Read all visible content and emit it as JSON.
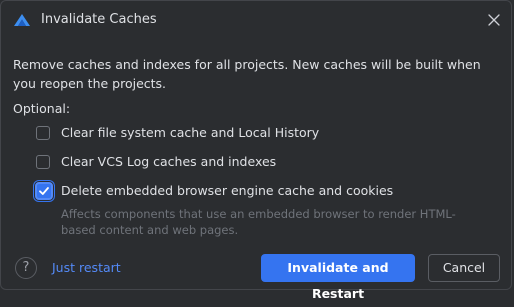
{
  "dialog": {
    "title": "Invalidate Caches",
    "description": "Remove caches and indexes for all projects. New caches will be built when you reopen the projects.",
    "optional_label": "Optional:",
    "options": [
      {
        "label": "Clear file system cache and Local History",
        "checked": false
      },
      {
        "label": "Clear VCS Log caches and indexes",
        "checked": false
      },
      {
        "label": "Delete embedded browser engine cache and cookies",
        "checked": true
      }
    ],
    "option_hint": "Affects components that use an embedded browser to render HTML-based content and web pages.",
    "help_glyph": "?",
    "just_restart_link": "Just restart",
    "primary_button": "Invalidate and Restart",
    "cancel_button": "Cancel"
  },
  "colors": {
    "background": "#2b2d30",
    "accent": "#3574f0",
    "link": "#548af7",
    "hint_text": "#6f737a"
  },
  "icons": [
    "app-logo-icon",
    "close-icon",
    "checkmark-icon",
    "help-icon"
  ]
}
